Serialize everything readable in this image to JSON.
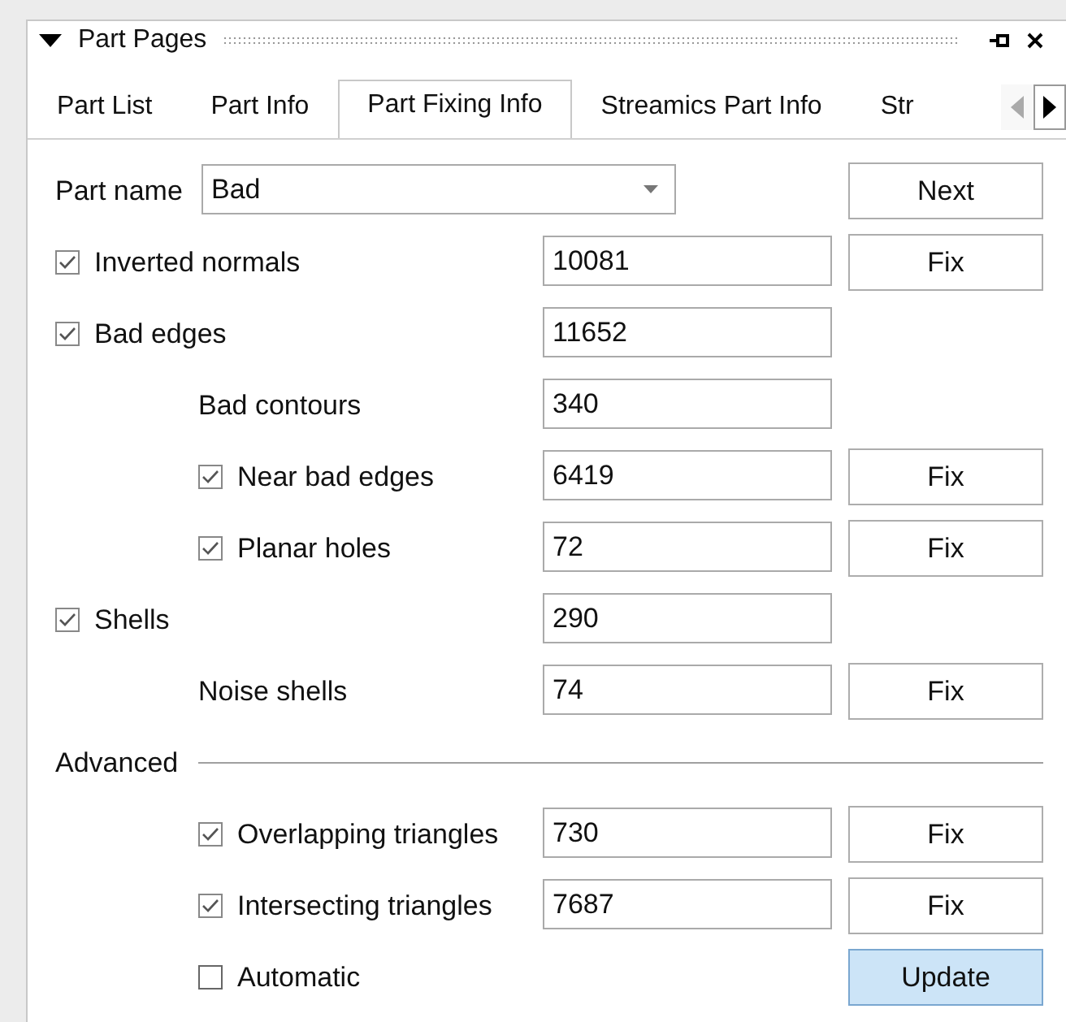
{
  "panel": {
    "title": "Part Pages",
    "expanded": true
  },
  "tabs": [
    {
      "label": "Part List",
      "selected": false
    },
    {
      "label": "Part Info",
      "selected": false
    },
    {
      "label": "Part Fixing Info",
      "selected": true
    },
    {
      "label": "Streamics Part Info",
      "selected": false
    },
    {
      "label": "Str",
      "selected": false
    }
  ],
  "part_name": {
    "label": "Part name",
    "value": "Bad",
    "button": {
      "label": "Next",
      "highlighted": false
    }
  },
  "rows": [
    {
      "kind": "checkbox",
      "indented": false,
      "label": "Inverted normals",
      "checked": true,
      "value": "10081",
      "button": {
        "label": "Fix",
        "highlighted": false
      }
    },
    {
      "kind": "checkbox",
      "indented": false,
      "label": "Bad edges",
      "checked": true,
      "value": "11652"
    },
    {
      "kind": "label",
      "indented": true,
      "label": "Bad contours",
      "value": "340"
    },
    {
      "kind": "checkbox",
      "indented": true,
      "label": "Near bad edges",
      "checked": true,
      "value": "6419",
      "button": {
        "label": "Fix",
        "highlighted": false
      }
    },
    {
      "kind": "checkbox",
      "indented": true,
      "label": "Planar holes",
      "checked": true,
      "value": "72",
      "button": {
        "label": "Fix",
        "highlighted": false
      }
    },
    {
      "kind": "checkbox",
      "indented": false,
      "label": "Shells",
      "checked": true,
      "value": "290"
    },
    {
      "kind": "label",
      "indented": true,
      "label": "Noise shells",
      "value": "74",
      "button": {
        "label": "Fix",
        "highlighted": false
      }
    },
    {
      "kind": "separator",
      "label": "Advanced"
    },
    {
      "kind": "checkbox",
      "indented": true,
      "label": "Overlapping triangles",
      "checked": true,
      "value": "730",
      "button": {
        "label": "Fix",
        "highlighted": false
      }
    },
    {
      "kind": "checkbox",
      "indented": true,
      "label": "Intersecting triangles",
      "checked": true,
      "value": "7687",
      "button": {
        "label": "Fix",
        "highlighted": false
      }
    },
    {
      "kind": "checkbox",
      "indented": true,
      "label": "Automatic",
      "checked": false,
      "button": {
        "label": "Update",
        "highlighted": true
      }
    }
  ]
}
